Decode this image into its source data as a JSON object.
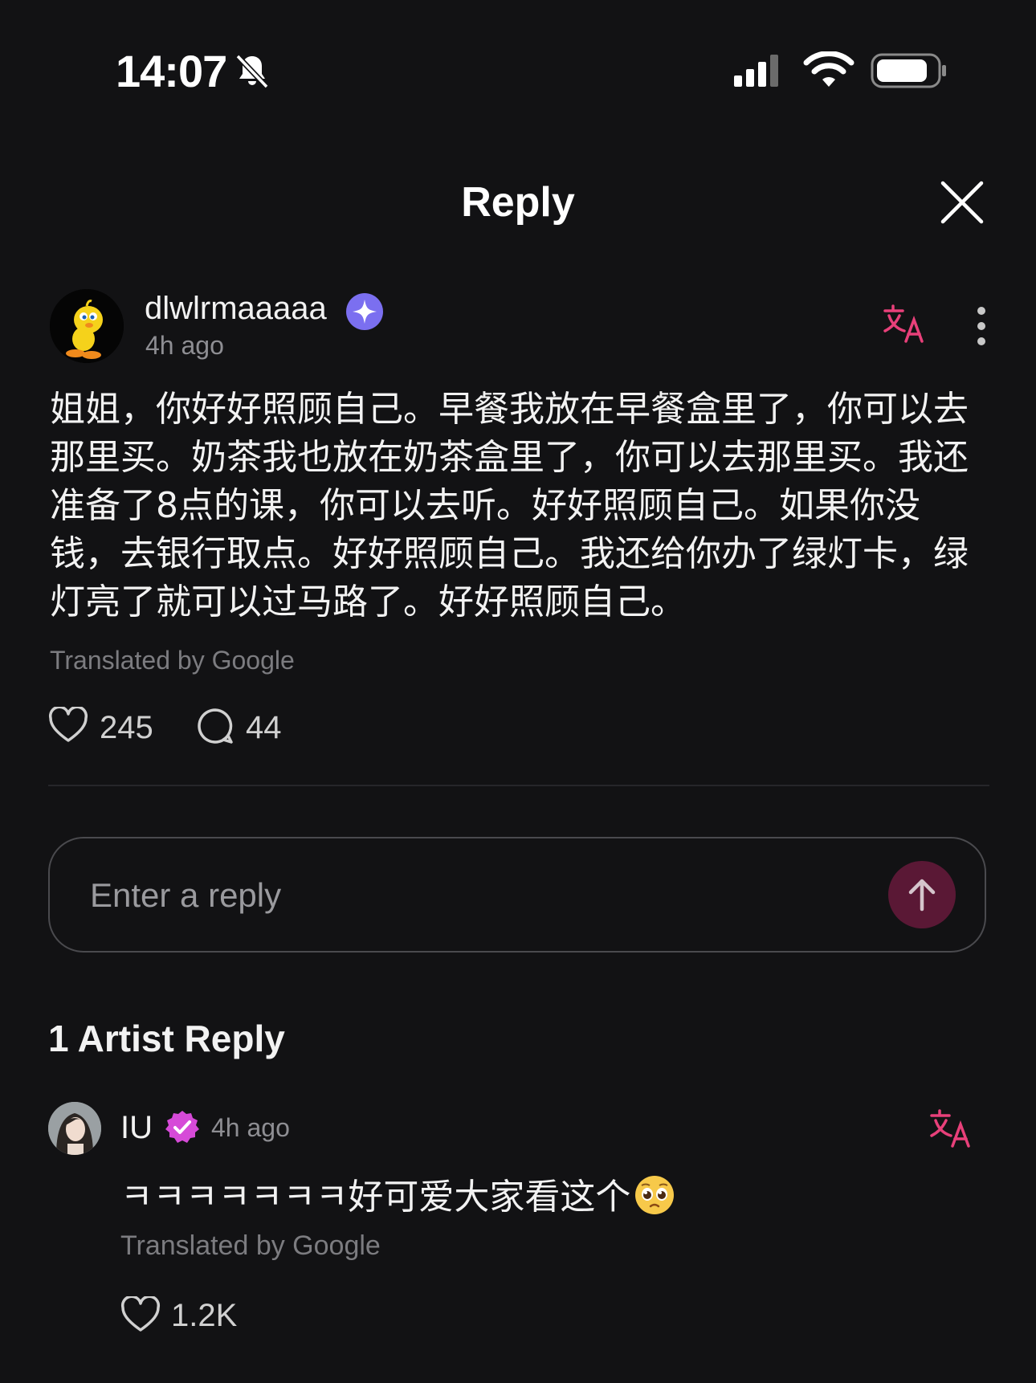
{
  "status_bar": {
    "time": "14:07"
  },
  "header": {
    "title": "Reply"
  },
  "post": {
    "username": "dlwlrmaaaaa",
    "time_ago": "4h ago",
    "text": "姐姐，你好好照顾自己。早餐我放在早餐盒里了，你可以去那里买。奶茶我也放在奶茶盒里了，你可以去那里买。我还准备了8点的课，你可以去听。好好照顾自己。如果你没钱，去银行取点。好好照顾自己。我还给你办了绿灯卡，绿灯亮了就可以过马路了。好好照顾自己。",
    "translation_note": "Translated by Google",
    "likes": "245",
    "comments": "44"
  },
  "reply_input": {
    "placeholder": "Enter a reply"
  },
  "artist_replies": {
    "heading": "1 Artist Reply",
    "items": [
      {
        "name": "IU",
        "time_ago": "4h ago",
        "text": "ㅋㅋㅋㅋㅋㅋㅋ好可爱大家看这个",
        "translation_note": "Translated by Google",
        "likes": "1.2K"
      }
    ]
  },
  "colors": {
    "background": "#121214",
    "accent_pink": "#e8407a",
    "badge_blue": "#7b6ff0",
    "badge_magenta": "#d64ad8",
    "send_button": "#5a1835"
  },
  "icons": {
    "status": [
      "bell-slash-icon",
      "cellular-signal-icon",
      "wifi-icon",
      "battery-icon"
    ],
    "header": [
      "close-icon"
    ],
    "post": [
      "verified-star-badge-icon",
      "translate-icon",
      "more-vertical-icon",
      "heart-icon",
      "comment-bubble-icon"
    ],
    "reply": [
      "arrow-up-icon"
    ],
    "artist": [
      "verified-check-badge-icon",
      "translate-icon",
      "pleading-face-emoji-icon",
      "heart-icon"
    ]
  }
}
